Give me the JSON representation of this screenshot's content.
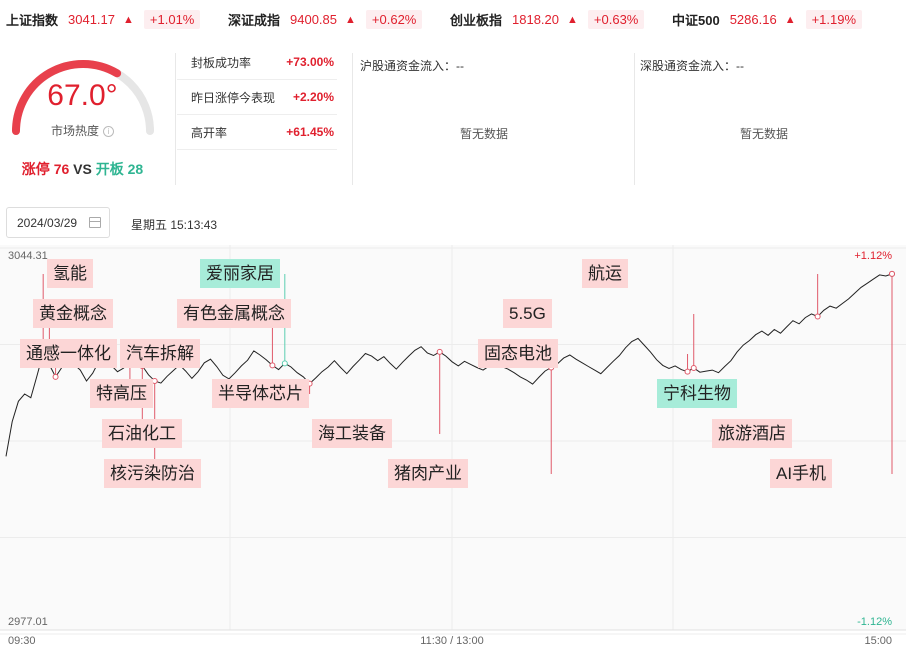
{
  "indices": [
    {
      "name": "上证指数",
      "value": "3041.17",
      "pct": "+1.01%"
    },
    {
      "name": "深证成指",
      "value": "9400.85",
      "pct": "+0.62%"
    },
    {
      "name": "创业板指",
      "value": "1818.20",
      "pct": "+0.63%"
    },
    {
      "name": "中证500",
      "value": "5286.16",
      "pct": "+1.19%"
    }
  ],
  "sentiment": {
    "value": "67.0°",
    "gauge_fraction": 0.67,
    "label": "市场热度",
    "limit_up_label": "涨停",
    "limit_up": "76",
    "vs": "VS",
    "open_label": "开板",
    "open": "28"
  },
  "stats": [
    {
      "label": "封板成功率",
      "value": "+73.00%"
    },
    {
      "label": "昨日涨停今表现",
      "value": "+2.20%"
    },
    {
      "label": "高开率",
      "value": "+61.45%"
    }
  ],
  "flows": {
    "hk_sh": {
      "label": "沪股通资金流入：--",
      "empty": "暂无数据"
    },
    "hk_sz": {
      "label": "深股通资金流入：--",
      "empty": "暂无数据"
    }
  },
  "date": "2024/03/29",
  "weekday_time": "星期五  15:13:43",
  "chart_data": {
    "type": "line",
    "y_max_label": "3044.31",
    "y_min_label": "2977.01",
    "pct_max_label": "+1.12%",
    "pct_min_label": "-1.12%",
    "ylim": [
      2977.01,
      3044.31
    ],
    "x_labels": [
      "09:30",
      "11:30 / 13:00",
      "15:00"
    ],
    "series": [
      {
        "values": [
          3007.5,
          3014.2,
          3018.1,
          3019.5,
          3018.8,
          3023.0,
          3027.4,
          3025.1,
          3022.8,
          3024.6,
          3026.3,
          3025.2,
          3024.1,
          3022.0,
          3023.5,
          3025.8,
          3026.4,
          3025.0,
          3023.8,
          3024.5,
          3026.8,
          3025.6,
          3024.9,
          3023.2,
          3022.0,
          3021.6,
          3022.9,
          3024.0,
          3025.1,
          3023.9,
          3022.5,
          3023.8,
          3025.5,
          3026.2,
          3024.8,
          3023.1,
          3022.4,
          3023.6,
          3024.9,
          3026.0,
          3027.8,
          3027.0,
          3026.1,
          3025.0,
          3024.2,
          3025.4,
          3024.7,
          3023.6,
          3022.8,
          3021.5,
          3022.6,
          3023.8,
          3024.7,
          3025.9,
          3024.6,
          3023.4,
          3024.8,
          3026.0,
          3027.3,
          3026.8,
          3025.9,
          3026.7,
          3025.4,
          3024.3,
          3025.6,
          3026.8,
          3027.9,
          3028.6,
          3027.4,
          3026.9,
          3027.6,
          3026.8,
          3025.7,
          3024.9,
          3025.8,
          3025.2,
          3024.6,
          3024.1,
          3024.9,
          3025.6,
          3024.8,
          3024.3,
          3023.6,
          3022.8,
          3022.2,
          3021.4,
          3022.7,
          3023.9,
          3024.6,
          3025.3,
          3026.4,
          3027.0,
          3026.2,
          3025.5,
          3024.8,
          3024.1,
          3023.4,
          3024.6,
          3025.8,
          3026.9,
          3028.4,
          3029.6,
          3030.2,
          3028.9,
          3027.6,
          3026.1,
          3025.0,
          3024.4,
          3024.9,
          3024.2,
          3023.8,
          3024.5,
          3023.7,
          3023.9,
          3024.1,
          3023.6,
          3024.8,
          3025.9,
          3027.6,
          3028.9,
          3029.8,
          3030.9,
          3031.6,
          3030.8,
          3031.9,
          3031.2,
          3032.4,
          3033.6,
          3033.0,
          3034.2,
          3034.9,
          3034.4,
          3035.6,
          3036.4,
          3036.0,
          3036.9,
          3037.8,
          3038.9,
          3040.0,
          3040.8,
          3041.6,
          3042.4,
          3042.2,
          3042.6
        ]
      }
    ],
    "markers": [
      {
        "label": "氢能",
        "color": "r",
        "idx": 6
      },
      {
        "label": "黄金概念",
        "color": "r",
        "idx": 7
      },
      {
        "label": "通感一体化",
        "color": "r",
        "idx": 8
      },
      {
        "label": "汽车拆解",
        "color": "r",
        "idx": 28
      },
      {
        "label": "特高压",
        "color": "r",
        "idx": 20
      },
      {
        "label": "石油化工",
        "color": "r",
        "idx": 22
      },
      {
        "label": "核污染防治",
        "color": "r",
        "idx": 24
      },
      {
        "label": "爱丽家居",
        "color": "g",
        "idx": 45
      },
      {
        "label": "有色金属概念",
        "color": "r",
        "idx": 43
      },
      {
        "label": "半导体芯片",
        "color": "r",
        "idx": 49
      },
      {
        "label": "海工装备",
        "color": "r",
        "idx": 70
      },
      {
        "label": "猪肉产业",
        "color": "r",
        "idx": 88
      },
      {
        "label": "5.5G",
        "color": "r",
        "idx": 111
      },
      {
        "label": "固态电池",
        "color": "r",
        "idx": 110
      },
      {
        "label": "航运",
        "color": "r",
        "idx": 131
      },
      {
        "label": "宁科生物",
        "color": "g",
        "idx": 148
      },
      {
        "label": "旅游酒店",
        "color": "r",
        "idx": 160
      },
      {
        "label": "AI手机",
        "color": "r",
        "idx": 172
      }
    ]
  }
}
